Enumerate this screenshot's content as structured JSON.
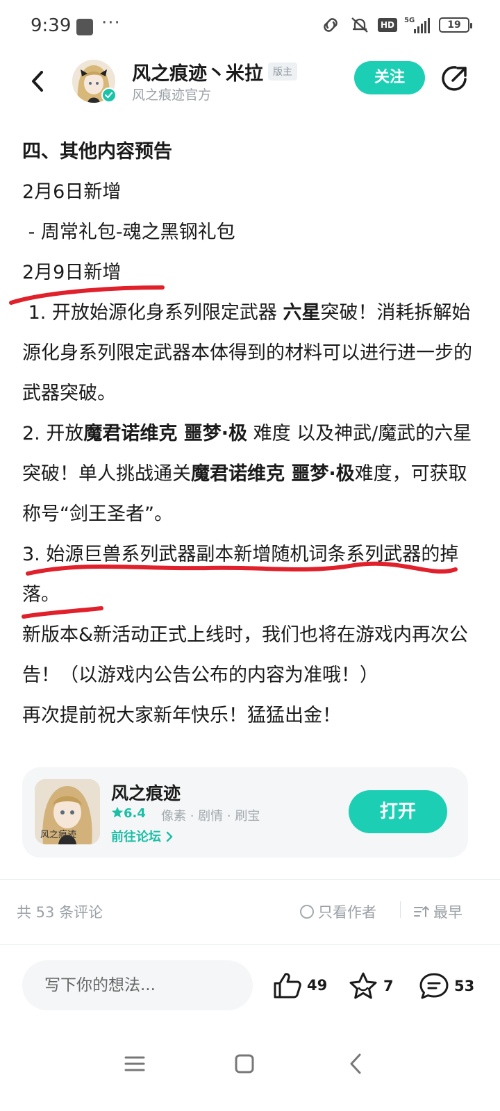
{
  "status_bar": {
    "time": "9:39",
    "dots": "···",
    "network": "5G",
    "hd": "HD",
    "battery": "19"
  },
  "header": {
    "author_name": "风之痕迹丶米拉",
    "role_badge": "版主",
    "subtitle": "风之痕迹官方",
    "follow_label": "关注"
  },
  "post": {
    "heading": "四、其他内容预告",
    "line1": "2月6日新增",
    "line2": " - 周常礼包-魂之黑钢礼包",
    "line3": "2月9日新增",
    "item1_a": " 1. 开放始源化身系列限定武器 ",
    "item1_b": "六星",
    "item1_c": "突破！消耗拆解始源化身系列限定武器本体得到的材料可以进行进一步的武器突破。",
    "item2_a": "2. 开放",
    "item2_b": "魔君诺维克 噩梦·极",
    "item2_c": " 难度 以及神武/魔武的六星突破！单人挑战通关",
    "item2_d": "魔君诺维克 噩梦·极",
    "item2_e": "难度，可获取称号“剑王圣者”。",
    "item3": "3. 始源巨兽系列武器副本新增随机词条系列武器的掉落。",
    "outro1": "新版本&新活动正式上线时，我们也将在游戏内再次公告！（以游戏内公告公布的内容为准哦！）",
    "outro2": "再次提前祝大家新年快乐！猛猛出金！"
  },
  "game_card": {
    "name": "风之痕迹",
    "rating": "6.4",
    "tags": "像素 · 剧情 · 刷宝",
    "forum_link": "前往论坛",
    "open_label": "打开",
    "icon_text": "风之痕迹"
  },
  "comments_bar": {
    "count_text": "共 53 条评论",
    "author_only": "只看作者",
    "sort_label": "最早"
  },
  "bottom_bar": {
    "input_placeholder": "写下你的想法...",
    "likes": "49",
    "favorites": "7",
    "comments": "53"
  },
  "colors": {
    "accent": "#1ccfb4",
    "marker": "#e0202a",
    "text": "#1a1a1a",
    "muted": "#9aa0a6"
  },
  "icons": [
    "back-arrow-icon",
    "share-icon",
    "verified-icon",
    "star-icon",
    "thumbs-up-icon",
    "favorite-star-icon",
    "comment-bubble-icon",
    "sort-icon",
    "menu-icon",
    "home-square-icon",
    "nav-back-icon"
  ]
}
